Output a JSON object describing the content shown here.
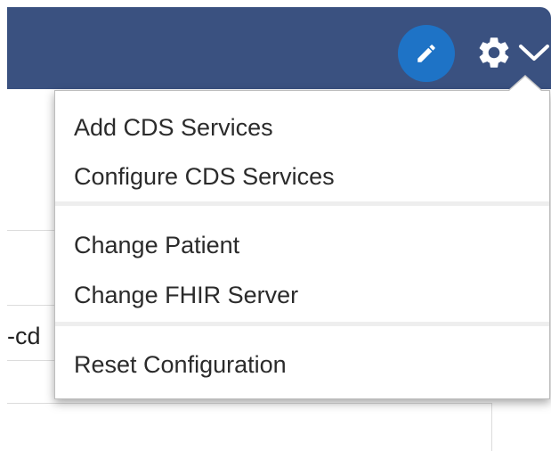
{
  "header": {
    "edit_icon": "pencil-icon",
    "settings_icon": "gear-icon",
    "dropdown_icon": "chevron-down-icon",
    "background_color": "#3a5180",
    "edit_button_color": "#1e73c6"
  },
  "background": {
    "partial_text": "-cd"
  },
  "menu": {
    "groups": [
      {
        "items": [
          {
            "label": "Add CDS Services"
          },
          {
            "label": "Configure CDS Services"
          }
        ]
      },
      {
        "items": [
          {
            "label": "Change Patient"
          },
          {
            "label": "Change FHIR Server"
          }
        ]
      },
      {
        "items": [
          {
            "label": "Reset Configuration"
          }
        ]
      }
    ]
  }
}
